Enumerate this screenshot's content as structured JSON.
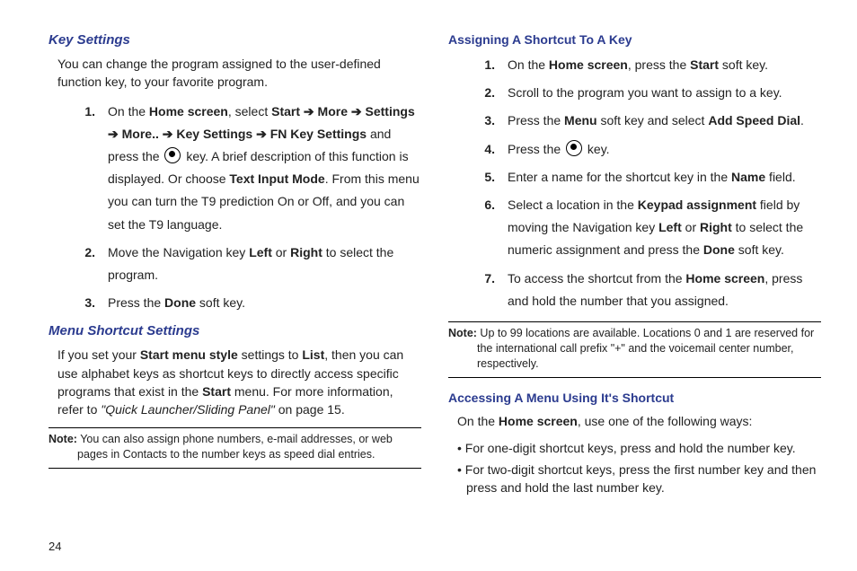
{
  "page_number": "24",
  "left": {
    "key_settings": {
      "heading": "Key Settings",
      "intro": "You can change the program assigned to the user-defined function key, to your favorite program.",
      "steps": [
        {
          "num": "1.",
          "pre": "On the ",
          "b1": "Home screen",
          "mid1": ", select ",
          "path": [
            "Start",
            "More",
            "Settings",
            "More..",
            "Key Settings",
            "FN Key Settings"
          ],
          "afterPath": " and press the ",
          "afterIcon": " key. A brief description of this function is displayed. Or choose ",
          "b2": "Text Input Mode",
          "tail": ". From this menu you can turn the T9 prediction On or Off, and you can set the T9 language."
        },
        {
          "num": "2.",
          "pre": "Move the Navigation key ",
          "b1": "Left",
          "mid1": " or ",
          "b2": "Right",
          "tail": " to select the program."
        },
        {
          "num": "3.",
          "pre": "Press the ",
          "b1": "Done",
          "tail": " soft key."
        }
      ]
    },
    "menu_shortcut": {
      "heading": "Menu Shortcut Settings",
      "para_pre": "If you set your ",
      "b1": "Start menu style",
      "mid1": " settings to ",
      "b2": "List",
      "mid2": ", then you can use alphabet keys as shortcut keys to directly access specific programs that exist in the ",
      "b3": "Start",
      "mid3": " menu. For more information, refer to ",
      "ref": "\"Quick Launcher/Sliding Panel\"",
      "tail": "  on page 15."
    },
    "note": {
      "label": "Note:",
      "text": " You can also assign phone numbers, e-mail addresses, or web pages in Contacts to the number keys as speed dial entries."
    }
  },
  "right": {
    "assign": {
      "heading": "Assigning A Shortcut To A Key",
      "steps": [
        {
          "num": "1.",
          "pre": "On the ",
          "b1": "Home screen",
          "mid1": ", press the ",
          "b2": "Start",
          "tail": " soft key."
        },
        {
          "num": "2.",
          "plain": "Scroll to the program you want to assign to a key."
        },
        {
          "num": "3.",
          "pre": "Press the ",
          "b1": "Menu",
          "mid1": " soft key and select ",
          "b2": "Add Speed Dial",
          "tail": "."
        },
        {
          "num": "4.",
          "pre": "Press the ",
          "icon": true,
          "tail": " key."
        },
        {
          "num": "5.",
          "pre": "Enter a name for the shortcut key in the ",
          "b1": "Name",
          "tail": " field."
        },
        {
          "num": "6.",
          "pre": "Select a location in the ",
          "b1": "Keypad assignment",
          "mid1": " field by moving the Navigation key ",
          "b2": "Left",
          "mid2": " or ",
          "b3": "Right",
          "mid3": " to select the numeric assignment and press the ",
          "b4": "Done",
          "tail": " soft key."
        },
        {
          "num": "7.",
          "pre": "To access the shortcut from the ",
          "b1": "Home screen",
          "tail": ", press and hold the number that you assigned."
        }
      ]
    },
    "note": {
      "label": "Note:",
      "text": " Up to 99 locations are available. Locations 0 and 1 are reserved for the international call prefix \"+\" and the voicemail center number, respectively."
    },
    "access": {
      "heading": "Accessing A Menu Using It's Shortcut",
      "intro_pre": "On the ",
      "intro_b": "Home screen",
      "intro_tail": ", use one of the following ways:",
      "bullets": [
        "For one-digit shortcut keys, press and hold the number key.",
        "For two-digit shortcut keys, press the first number key and then press and hold the last number key."
      ]
    }
  }
}
